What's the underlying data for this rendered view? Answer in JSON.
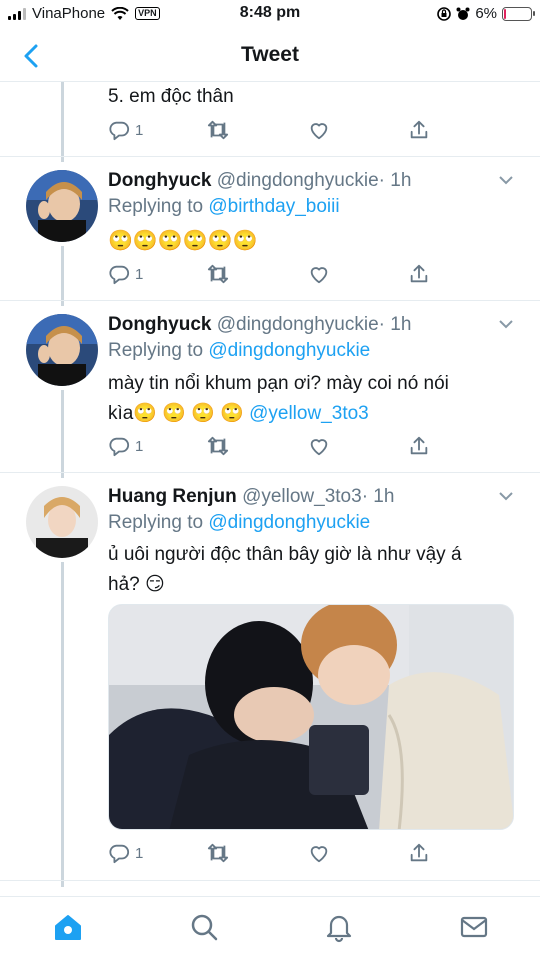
{
  "status_bar": {
    "carrier": "VinaPhone",
    "vpn": "VPN",
    "time": "8:48 pm",
    "battery": "6%",
    "battery_level": 0.06
  },
  "header": {
    "title": "Tweet"
  },
  "tweets": [
    {
      "text": "5. em độc thân",
      "reply_count": "1"
    },
    {
      "name": "Donghyuck",
      "handle": "@dingdonghyuckie",
      "time": "· 1h",
      "replying_prefix": "Replying to",
      "replying_to": "@birthday_boiii",
      "text": "🙄🙄🙄🙄🙄🙄",
      "reply_count": "1"
    },
    {
      "name": "Donghyuck",
      "handle": "@dingdonghyuckie",
      "time": "· 1h",
      "replying_prefix": "Replying to",
      "replying_to": "@dingdonghyuckie",
      "text_line1": "mày tin nổi khum pạn ơi? mày coi nó nói",
      "text_line2": "kìa🙄 🙄 🙄  🙄",
      "text_mention": "@yellow_3to3",
      "reply_count": "1"
    },
    {
      "name": "Huang Renjun",
      "handle": "@yellow_3to3",
      "time": "· 1h",
      "replying_prefix": "Replying to",
      "replying_to": "@dingdonghyuckie",
      "text_line1": "ủ uôi người độc thân bây giờ là như vậy á",
      "text_line2": "hả? 😏",
      "reply_count": "1"
    }
  ],
  "icons": {
    "reply": "reply-icon",
    "retweet": "retweet-icon",
    "like": "heart-icon",
    "share": "share-icon",
    "caret": "chevron-down-icon",
    "tabs": [
      "home-icon",
      "search-icon",
      "notifications-icon",
      "messages-icon"
    ]
  },
  "colors": {
    "accent": "#1da1f2",
    "muted": "#657786",
    "text": "#14171a",
    "divider": "#e6ecf0"
  }
}
